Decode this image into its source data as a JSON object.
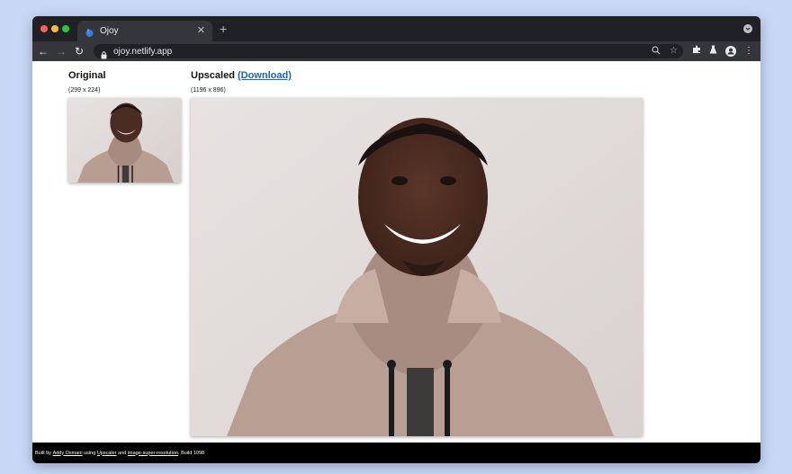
{
  "browser": {
    "tab_title": "Ojoy",
    "url": "ojoy.netlify.app",
    "new_tab_symbol": "+",
    "close_symbol": "✕",
    "colors": {
      "frame": "#202124",
      "toolbar": "#35363a",
      "text": "#e8eaed"
    }
  },
  "page": {
    "original_heading": "Original",
    "original_dims": "(299 x 224)",
    "upscaled_heading": "Upscaled",
    "download_label": "(Download)",
    "upscaled_dims": "(1196 x 896)",
    "accent": "#1a62c7"
  },
  "footer": {
    "built_by": "Built by",
    "author": "Addy Osmani",
    "using": "using",
    "tool": "Upscaler",
    "and": "and",
    "library": "image-super-resolution",
    "build": ". Build 1098"
  },
  "background_color": "#c9d7f7"
}
